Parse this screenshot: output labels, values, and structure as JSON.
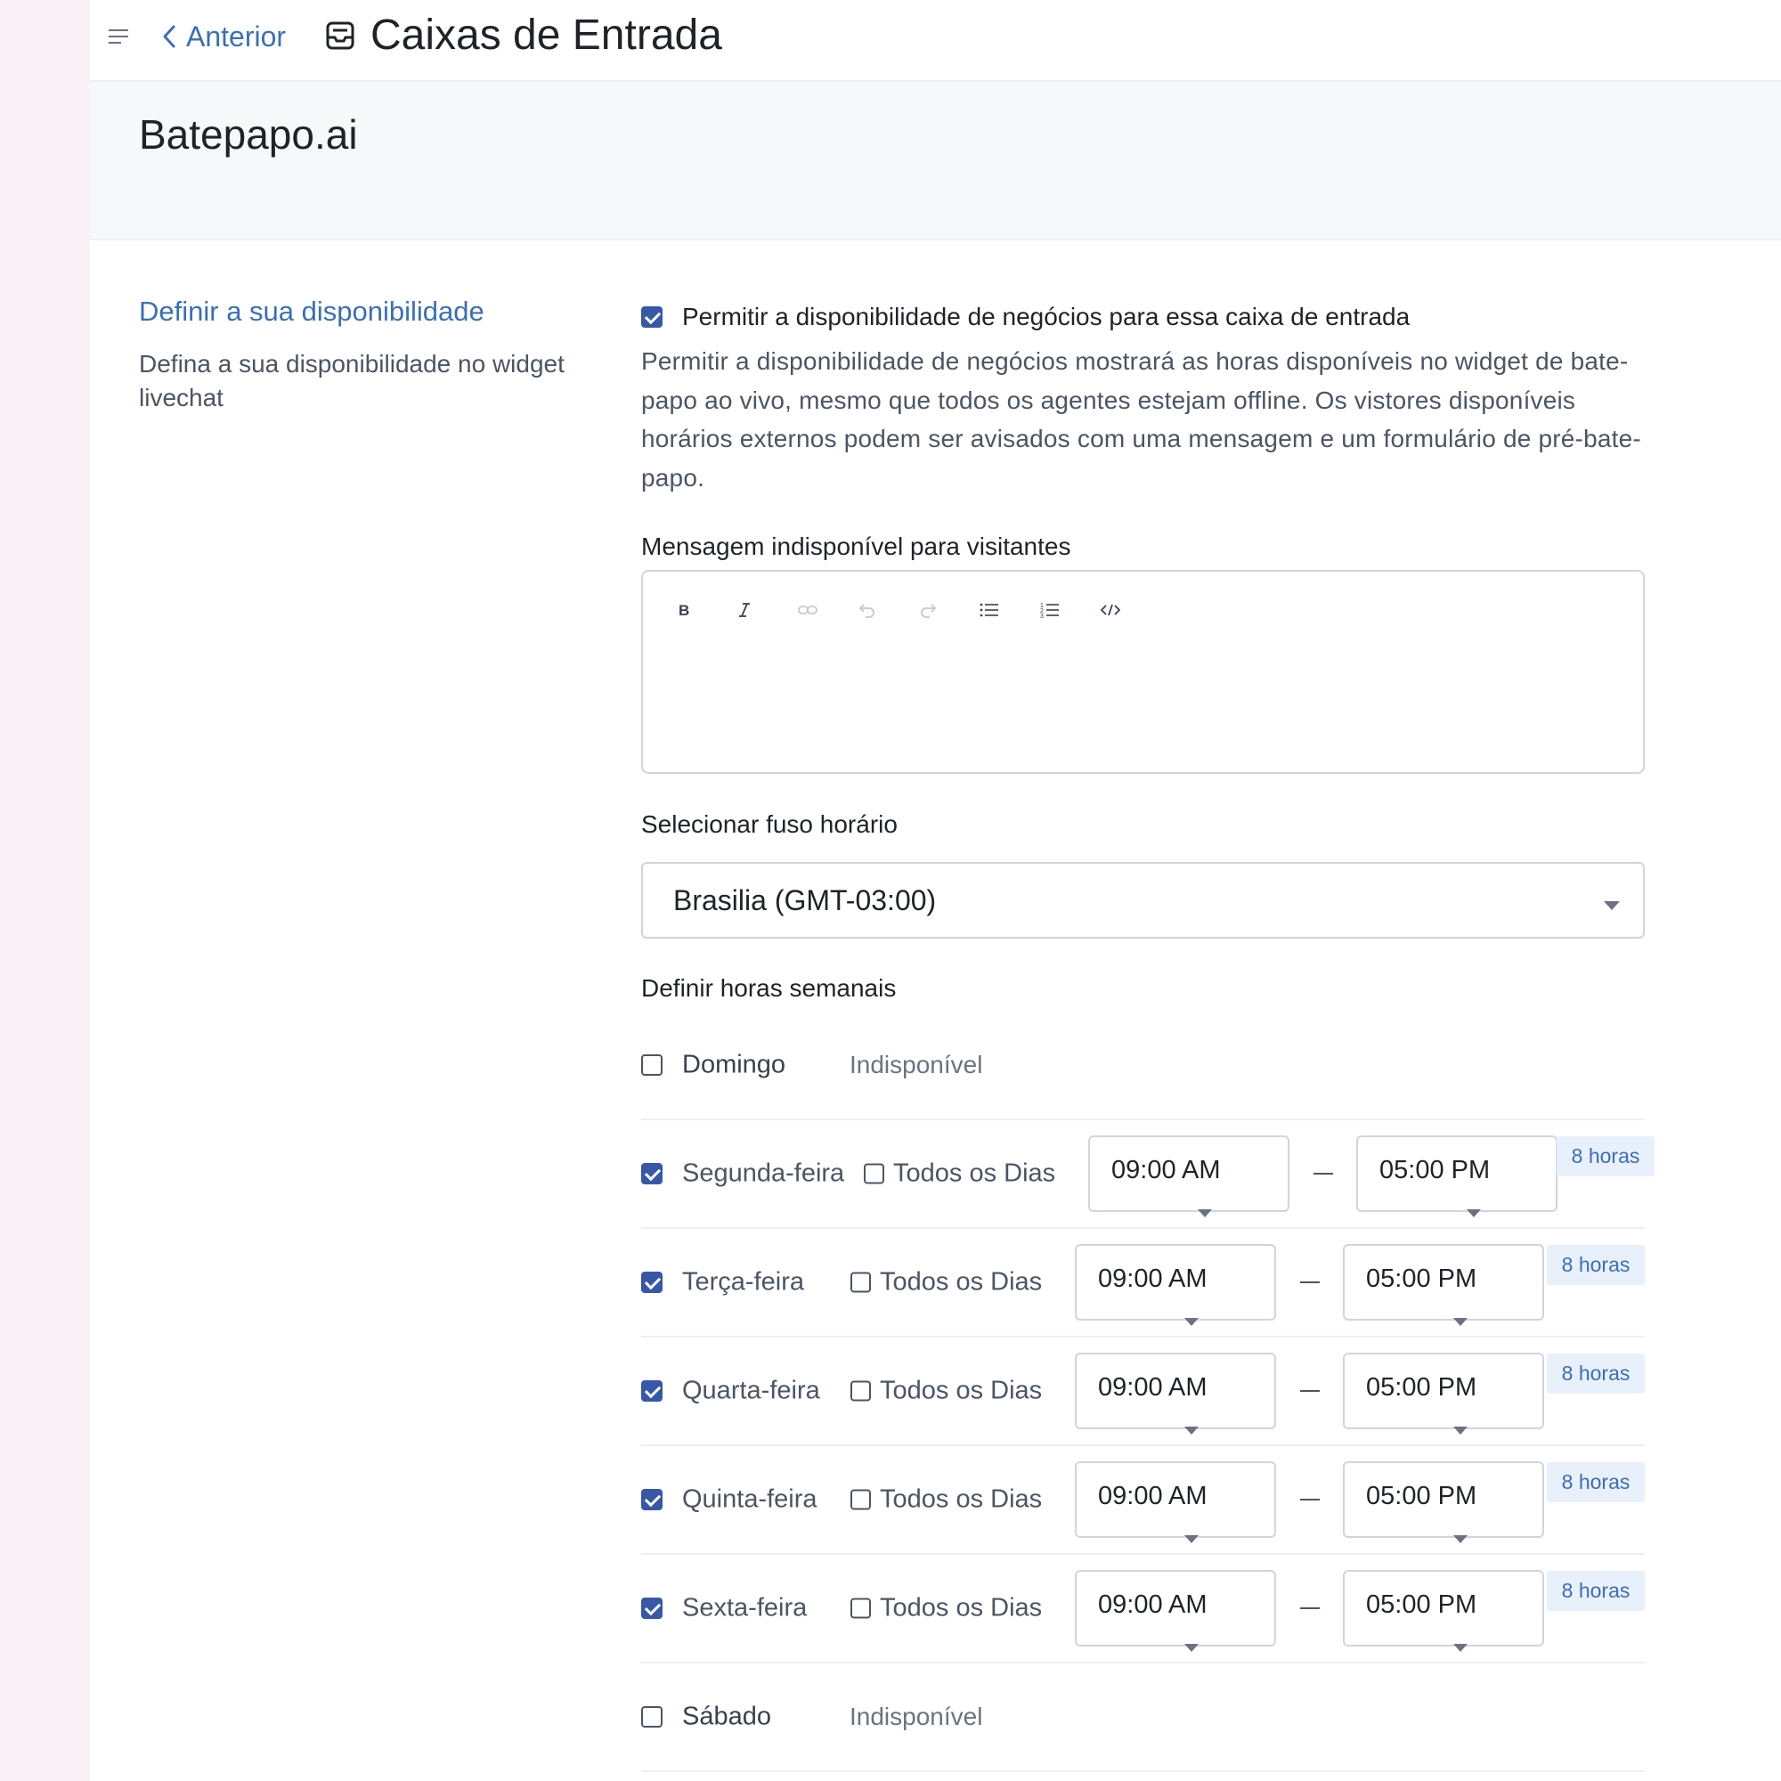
{
  "topbar": {
    "back_label": "Anterior",
    "title": "Caixas de Entrada"
  },
  "inbox": {
    "name": "Batepapo.ai"
  },
  "section": {
    "title": "Definir a sua disponibilidade",
    "description": "Defina a sua disponibilidade no widget livechat"
  },
  "availability": {
    "enabled": true,
    "enable_label": "Permitir a disponibilidade de negócios para essa caixa de entrada",
    "enable_description": "Permitir a disponibilidade de negócios mostrará as horas disponíveis no widget de bate-papo ao vivo, mesmo que todos os agentes estejam offline. Os vistores disponíveis horários externos podem ser avisados com uma mensagem e um formulário de pré-bate-papo."
  },
  "message": {
    "label": "Mensagem indisponível para visitantes",
    "toolbar": [
      {
        "icon": "bold-icon",
        "glyph": "B",
        "enabled": true
      },
      {
        "icon": "italic-icon",
        "glyph": "I",
        "enabled": true
      },
      {
        "icon": "link-icon",
        "enabled": false
      },
      {
        "icon": "undo-icon",
        "enabled": false
      },
      {
        "icon": "redo-icon",
        "enabled": false
      },
      {
        "icon": "bullet-list-icon",
        "enabled": true
      },
      {
        "icon": "ordered-list-icon",
        "enabled": true
      },
      {
        "icon": "code-icon",
        "enabled": true
      }
    ],
    "value": ""
  },
  "timezone": {
    "label": "Selecionar fuso horário",
    "value": "Brasilia (GMT-03:00)"
  },
  "weekly": {
    "label": "Definir horas semanais",
    "all_day_label": "Todos os Dias",
    "unavailable_label": "Indisponível",
    "days": [
      {
        "name": "Domingo",
        "enabled": false
      },
      {
        "name": "Segunda-feira",
        "enabled": true,
        "all_day": false,
        "open": "09:00 AM",
        "close": "05:00 PM",
        "hours": "8 horas"
      },
      {
        "name": "Terça-feira",
        "enabled": true,
        "all_day": false,
        "open": "09:00 AM",
        "close": "05:00 PM",
        "hours": "8 horas"
      },
      {
        "name": "Quarta-feira",
        "enabled": true,
        "all_day": false,
        "open": "09:00 AM",
        "close": "05:00 PM",
        "hours": "8 horas"
      },
      {
        "name": "Quinta-feira",
        "enabled": true,
        "all_day": false,
        "open": "09:00 AM",
        "close": "05:00 PM",
        "hours": "8 horas"
      },
      {
        "name": "Sexta-feira",
        "enabled": true,
        "all_day": false,
        "open": "09:00 AM",
        "close": "05:00 PM",
        "hours": "8 horas"
      },
      {
        "name": "Sábado",
        "enabled": false
      }
    ]
  },
  "colors": {
    "accent": "#3b6fb6",
    "checkbox": "#3758a6",
    "badge_bg": "#e8f0fb"
  }
}
